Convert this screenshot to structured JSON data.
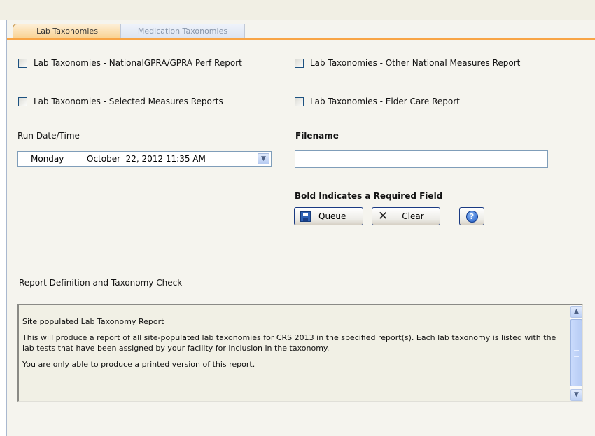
{
  "tabs": [
    {
      "label": "Lab Taxonomies",
      "active": true
    },
    {
      "label": "Medication Taxonomies",
      "active": false
    }
  ],
  "checkboxes": {
    "national_gpra": {
      "label": "Lab Taxonomies - NationalGPRA/GPRA Perf Report",
      "checked": false
    },
    "other_national": {
      "label": "Lab Taxonomies - Other National Measures Report",
      "checked": false
    },
    "selected_measures": {
      "label": "Lab Taxonomies - Selected Measures Reports",
      "checked": false
    },
    "elder_care": {
      "label": "Lab Taxonomies - Elder Care Report",
      "checked": false
    }
  },
  "run_datetime": {
    "label": "Run Date/Time",
    "day": "Monday",
    "date": "October  22, 2012 11:35 AM",
    "dropdown_icon": "chevron-down-icon"
  },
  "filename": {
    "label": "Filename",
    "value": ""
  },
  "required_note": "Bold Indicates a Required Field",
  "buttons": {
    "queue": {
      "label": "Queue",
      "icon": "floppy-disk-icon"
    },
    "clear": {
      "label": "Clear",
      "icon": "x-icon"
    },
    "help": {
      "icon": "help-icon",
      "glyph": "?"
    }
  },
  "report_section": {
    "label": "Report Definition and Taxonomy Check",
    "paragraphs": [
      "Site populated Lab Taxonomy Report",
      "This will produce a report of all site-populated lab taxonomies for CRS 2013 in the specified report(s).  Each lab taxonomy is listed with the lab tests that have been assigned by your facility for inclusion in the taxonomy.",
      "You are only able to produce a printed version of this report."
    ]
  },
  "colors": {
    "active_tab_accent": "#f8a445",
    "panel_background": "#f5f4ee",
    "button_border": "#1a3a82"
  }
}
